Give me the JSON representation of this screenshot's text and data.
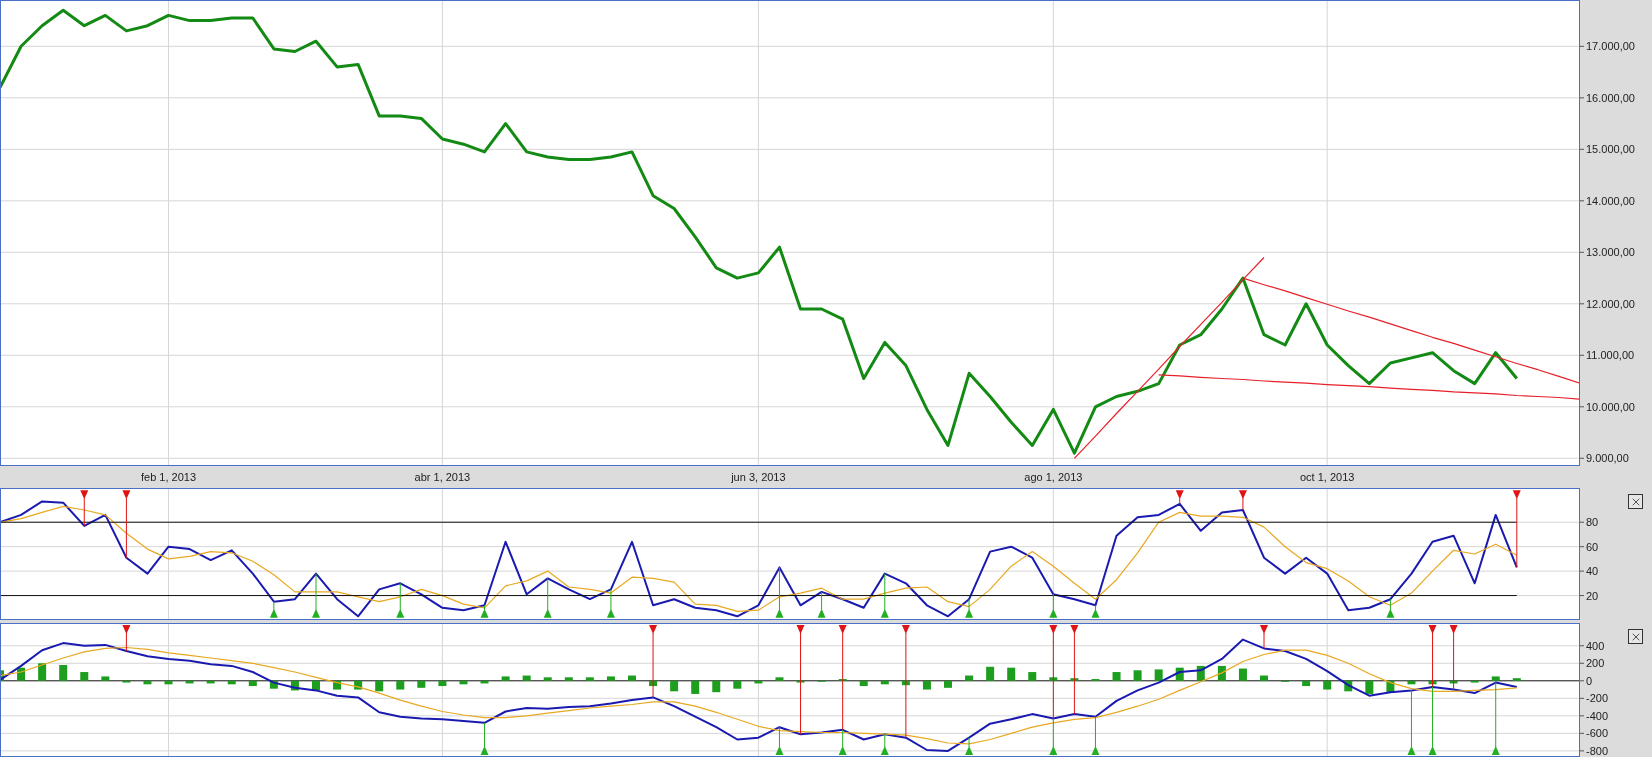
{
  "price_chart": {
    "chart_data": {
      "type": "line",
      "grid": true,
      "categories": [
        null,
        null,
        null,
        null,
        null,
        null,
        null,
        null,
        "feb 1, 2013",
        null,
        null,
        null,
        null,
        null,
        null,
        null,
        null,
        null,
        null,
        null,
        null,
        "abr 1, 2013",
        null,
        null,
        null,
        null,
        null,
        null,
        null,
        null,
        null,
        null,
        null,
        null,
        null,
        null,
        "jun 3, 2013",
        null,
        null,
        null,
        null,
        null,
        null,
        null,
        null,
        null,
        null,
        null,
        null,
        null,
        "ago 1, 2013",
        null,
        null,
        null,
        null,
        null,
        null,
        null,
        null,
        null,
        null,
        null,
        null,
        "oct 1, 2013",
        null,
        null,
        null,
        null,
        null,
        null,
        null,
        null,
        null,
        null,
        null,
        null
      ],
      "series": [
        {
          "color": "#138a13",
          "values": [
            16200,
            17000,
            17400,
            17700,
            17400,
            17600,
            17300,
            17400,
            17600,
            17500,
            17500,
            17550,
            17550,
            16950,
            16900,
            17100,
            16600,
            16650,
            15650,
            15650,
            15600,
            15200,
            15100,
            14950,
            15500,
            14950,
            14850,
            14800,
            14800,
            14850,
            14950,
            14100,
            13850,
            13300,
            12700,
            12500,
            12600,
            13100,
            11900,
            11900,
            11700,
            10550,
            11250,
            10800,
            9950,
            9250,
            10650,
            10200,
            9700,
            9250,
            9950,
            9100,
            10000,
            10200,
            10300,
            10450,
            11200,
            11400,
            11900,
            12500,
            11400,
            11200,
            12000,
            11200,
            10800,
            10450,
            10850,
            10950,
            11050,
            10700,
            10450,
            11050,
            10550,
            null,
            null,
            null
          ]
        },
        {
          "color": "#e8202a",
          "values": [
            null,
            null,
            null,
            null,
            null,
            null,
            null,
            null,
            null,
            null,
            null,
            null,
            null,
            null,
            null,
            null,
            null,
            null,
            null,
            null,
            null,
            null,
            null,
            null,
            null,
            null,
            null,
            null,
            null,
            null,
            null,
            null,
            null,
            null,
            null,
            null,
            null,
            null,
            null,
            null,
            null,
            null,
            null,
            null,
            null,
            null,
            null,
            null,
            null,
            null,
            null,
            9000,
            9430,
            9870,
            10300,
            10730,
            11170,
            11600,
            12030,
            12470,
            12900,
            null,
            null,
            null,
            null,
            null,
            null,
            null,
            null,
            null,
            null,
            null,
            null,
            null,
            null,
            null
          ]
        },
        {
          "color": "#e8202a",
          "values": [
            null,
            null,
            null,
            null,
            null,
            null,
            null,
            null,
            null,
            null,
            null,
            null,
            null,
            null,
            null,
            null,
            null,
            null,
            null,
            null,
            null,
            null,
            null,
            null,
            null,
            null,
            null,
            null,
            null,
            null,
            null,
            null,
            null,
            null,
            null,
            null,
            null,
            null,
            null,
            null,
            null,
            null,
            null,
            null,
            null,
            null,
            null,
            null,
            null,
            null,
            null,
            null,
            null,
            null,
            null,
            null,
            null,
            null,
            null,
            12500,
            12370,
            12250,
            12120,
            11990,
            11860,
            11740,
            11610,
            11480,
            11350,
            11230,
            11100,
            10970,
            10840,
            10720,
            10590,
            10460
          ]
        },
        {
          "color": "#e8202a",
          "values": [
            null,
            null,
            null,
            null,
            null,
            null,
            null,
            null,
            null,
            null,
            null,
            null,
            null,
            null,
            null,
            null,
            null,
            null,
            null,
            null,
            null,
            null,
            null,
            null,
            null,
            null,
            null,
            null,
            null,
            null,
            null,
            null,
            null,
            null,
            null,
            null,
            null,
            null,
            null,
            null,
            null,
            null,
            null,
            null,
            null,
            null,
            null,
            null,
            null,
            null,
            null,
            null,
            null,
            null,
            null,
            10620,
            10600,
            10570,
            10550,
            10530,
            10500,
            10480,
            10460,
            10430,
            10410,
            10390,
            10360,
            10340,
            10320,
            10290,
            10270,
            10250,
            10220,
            10200,
            10180,
            10150
          ]
        }
      ],
      "ylim": [
        8850,
        17900
      ],
      "yticks": [
        {
          "value": 9000,
          "label": "9.000,00"
        },
        {
          "value": 10000,
          "label": "10.000,00"
        },
        {
          "value": 11000,
          "label": "11.000,00"
        },
        {
          "value": 12000,
          "label": "12.000,00"
        },
        {
          "value": 13000,
          "label": "13.000,00"
        },
        {
          "value": 14000,
          "label": "14.000,00"
        },
        {
          "value": 15000,
          "label": "15.000,00"
        },
        {
          "value": 16000,
          "label": "16.000,00"
        },
        {
          "value": 17000,
          "label": "17.000,00"
        }
      ]
    }
  },
  "stochastic_panel": {
    "chart_data": {
      "type": "line",
      "grid": true,
      "series": [
        {
          "color": "#1a1ab0",
          "values": [
            80,
            86,
            97,
            96,
            77,
            86,
            51,
            38,
            60,
            58,
            49,
            57,
            38,
            15,
            17,
            38,
            17,
            3,
            25,
            30,
            21,
            10,
            8,
            12,
            64,
            21,
            34,
            25,
            17,
            25,
            64,
            12,
            17,
            10,
            8,
            3,
            12,
            43,
            12,
            23,
            17,
            10,
            38,
            30,
            12,
            3,
            17,
            56,
            60,
            51,
            21,
            17,
            12,
            69,
            84,
            86,
            95,
            73,
            88,
            90,
            51,
            38,
            51,
            38,
            8,
            10,
            17,
            38,
            64,
            69,
            30,
            86,
            43
          ]
        },
        {
          "color": "#e8a820",
          "values": [
            80,
            83,
            88,
            93,
            90,
            86,
            71,
            58,
            50,
            52,
            56,
            55,
            48,
            37,
            23,
            23,
            23,
            19,
            15,
            19,
            25,
            20,
            13,
            10,
            28,
            32,
            40,
            27,
            25,
            22,
            35,
            34,
            31,
            13,
            12,
            7,
            8,
            19,
            22,
            26,
            17,
            17,
            22,
            26,
            27,
            15,
            11,
            25,
            44,
            56,
            44,
            30,
            17,
            33,
            55,
            80,
            88,
            85,
            85,
            84,
            76,
            60,
            47,
            42,
            32,
            19,
            12,
            22,
            40,
            57,
            54,
            62,
            53
          ]
        },
        {
          "color": "#111111",
          "values": [
            80,
            80,
            80,
            80,
            80,
            80,
            80,
            80,
            80,
            80,
            80,
            80,
            80,
            80,
            80,
            80,
            80,
            80,
            80,
            80,
            80,
            80,
            80,
            80,
            80,
            80,
            80,
            80,
            80,
            80,
            80,
            80,
            80,
            80,
            80,
            80,
            80,
            80,
            80,
            80,
            80,
            80,
            80,
            80,
            80,
            80,
            80,
            80,
            80,
            80,
            80,
            80,
            80,
            80,
            80,
            80,
            80,
            80,
            80,
            80,
            80,
            80,
            80,
            80,
            80,
            80,
            80,
            80,
            80,
            80,
            80,
            80,
            80
          ]
        },
        {
          "color": "#111111",
          "values": [
            20,
            20,
            20,
            20,
            20,
            20,
            20,
            20,
            20,
            20,
            20,
            20,
            20,
            20,
            20,
            20,
            20,
            20,
            20,
            20,
            20,
            20,
            20,
            20,
            20,
            20,
            20,
            20,
            20,
            20,
            20,
            20,
            20,
            20,
            20,
            20,
            20,
            20,
            20,
            20,
            20,
            20,
            20,
            20,
            20,
            20,
            20,
            20,
            20,
            20,
            20,
            20,
            20,
            20,
            20,
            20,
            20,
            20,
            20,
            20,
            20,
            20,
            20,
            20,
            20,
            20,
            20,
            20,
            20,
            20,
            20,
            20,
            20
          ]
        },
        {
          "type": "scatter",
          "color": "#e01414",
          "values": [
            null,
            null,
            null,
            null,
            102,
            null,
            102,
            null,
            null,
            null,
            null,
            null,
            null,
            null,
            null,
            null,
            null,
            null,
            null,
            null,
            null,
            null,
            null,
            null,
            null,
            null,
            null,
            null,
            null,
            null,
            null,
            null,
            null,
            null,
            null,
            null,
            null,
            null,
            null,
            null,
            null,
            null,
            null,
            null,
            null,
            null,
            null,
            null,
            null,
            null,
            null,
            null,
            null,
            null,
            null,
            null,
            102,
            null,
            null,
            102,
            null,
            null,
            null,
            null,
            null,
            null,
            null,
            null,
            null,
            null,
            null,
            null,
            102
          ]
        },
        {
          "type": "scatter",
          "color": "#22b022",
          "values": [
            null,
            null,
            null,
            null,
            null,
            null,
            null,
            null,
            null,
            null,
            null,
            null,
            null,
            6,
            null,
            6,
            null,
            null,
            null,
            6,
            null,
            null,
            null,
            6,
            null,
            null,
            6,
            null,
            null,
            6,
            null,
            null,
            null,
            null,
            null,
            null,
            null,
            6,
            null,
            6,
            null,
            null,
            6,
            null,
            null,
            null,
            6,
            null,
            null,
            null,
            6,
            null,
            6,
            null,
            null,
            null,
            null,
            null,
            null,
            null,
            null,
            null,
            null,
            null,
            null,
            null,
            6,
            null,
            null,
            null,
            null,
            null,
            null
          ]
        }
      ],
      "ylim": [
        0,
        108
      ],
      "yticks": [
        {
          "value": 20,
          "label": "20"
        },
        {
          "value": 40,
          "label": "40"
        },
        {
          "value": 60,
          "label": "60"
        },
        {
          "value": 80,
          "label": "80"
        }
      ]
    }
  },
  "macd_panel": {
    "chart_data": {
      "type": "line",
      "grid": true,
      "series": [
        {
          "type": "bar",
          "color": "#1e9e1e",
          "values": [
            120,
            150,
            200,
            180,
            100,
            50,
            -20,
            -40,
            -40,
            -30,
            -30,
            -40,
            -60,
            -90,
            -110,
            -110,
            -100,
            -100,
            -120,
            -100,
            -80,
            -60,
            -40,
            -30,
            50,
            60,
            40,
            40,
            40,
            50,
            60,
            -60,
            -120,
            -150,
            -130,
            -90,
            -30,
            40,
            -20,
            -10,
            20,
            -60,
            -40,
            -50,
            -100,
            -80,
            60,
            160,
            150,
            100,
            40,
            30,
            20,
            100,
            120,
            130,
            150,
            170,
            170,
            140,
            60,
            -10,
            -60,
            -100,
            -120,
            -150,
            -130,
            -40,
            -40,
            -30,
            -20,
            50,
            30
          ]
        },
        {
          "color": "#1a1ab0",
          "values": [
            10,
            170,
            350,
            430,
            400,
            410,
            340,
            280,
            250,
            230,
            190,
            170,
            100,
            -20,
            -80,
            -110,
            -170,
            -190,
            -360,
            -410,
            -430,
            -440,
            -460,
            -480,
            -350,
            -310,
            -320,
            -300,
            -290,
            -260,
            -220,
            -190,
            -290,
            -410,
            -530,
            -670,
            -650,
            -530,
            -610,
            -590,
            -560,
            -670,
            -610,
            -650,
            -790,
            -800,
            -650,
            -490,
            -440,
            -380,
            -430,
            -380,
            -410,
            -230,
            -110,
            -20,
            100,
            120,
            250,
            470,
            370,
            340,
            250,
            110,
            -50,
            -170,
            -130,
            -110,
            -70,
            -100,
            -140,
            -20,
            -70
          ]
        },
        {
          "color": "#e8a820",
          "values": [
            60,
            100,
            180,
            260,
            330,
            370,
            380,
            360,
            320,
            290,
            260,
            230,
            200,
            150,
            100,
            40,
            -20,
            -70,
            -140,
            -220,
            -290,
            -350,
            -390,
            -420,
            -420,
            -400,
            -370,
            -340,
            -310,
            -290,
            -270,
            -240,
            -240,
            -290,
            -360,
            -440,
            -520,
            -570,
            -580,
            -590,
            -590,
            -600,
            -610,
            -620,
            -660,
            -710,
            -720,
            -670,
            -600,
            -530,
            -480,
            -440,
            -420,
            -360,
            -290,
            -210,
            -110,
            -10,
            90,
            220,
            300,
            350,
            350,
            290,
            200,
            80,
            -20,
            -90,
            -120,
            -120,
            -110,
            -100,
            -80
          ]
        },
        {
          "type": "scatter",
          "color": "#e01414",
          "values": [
            null,
            null,
            null,
            null,
            null,
            null,
            580,
            null,
            null,
            null,
            null,
            null,
            null,
            null,
            null,
            null,
            null,
            null,
            null,
            null,
            null,
            null,
            null,
            null,
            null,
            null,
            null,
            null,
            null,
            null,
            null,
            580,
            null,
            null,
            null,
            null,
            null,
            null,
            580,
            null,
            580,
            null,
            null,
            580,
            null,
            null,
            null,
            null,
            null,
            null,
            580,
            580,
            null,
            null,
            null,
            null,
            null,
            null,
            null,
            null,
            580,
            null,
            null,
            null,
            null,
            null,
            null,
            null,
            580,
            580,
            null,
            null,
            null
          ]
        },
        {
          "type": "scatter",
          "color": "#22b022",
          "values": [
            null,
            null,
            null,
            null,
            null,
            null,
            null,
            null,
            null,
            null,
            null,
            null,
            null,
            null,
            null,
            null,
            null,
            null,
            null,
            null,
            null,
            null,
            null,
            -790,
            null,
            null,
            null,
            null,
            null,
            null,
            null,
            null,
            null,
            null,
            null,
            null,
            null,
            -790,
            null,
            null,
            -790,
            null,
            -790,
            null,
            null,
            null,
            -790,
            null,
            null,
            null,
            -790,
            null,
            -790,
            null,
            null,
            null,
            null,
            null,
            null,
            null,
            null,
            null,
            null,
            null,
            null,
            null,
            null,
            -790,
            -790,
            null,
            null,
            -790,
            null
          ]
        }
      ],
      "ylim": [
        -870,
        660
      ],
      "yticks": [
        {
          "value": 400,
          "label": "400"
        },
        {
          "value": 200,
          "label": "200"
        },
        {
          "value": 0,
          "label": "0"
        },
        {
          "value": -200,
          "label": "-200"
        },
        {
          "value": -400,
          "label": "-400"
        },
        {
          "value": -600,
          "label": "-600"
        },
        {
          "value": -800,
          "label": "-800"
        }
      ],
      "ref_lines": [
        {
          "axis": "y",
          "value": 0
        }
      ]
    }
  }
}
